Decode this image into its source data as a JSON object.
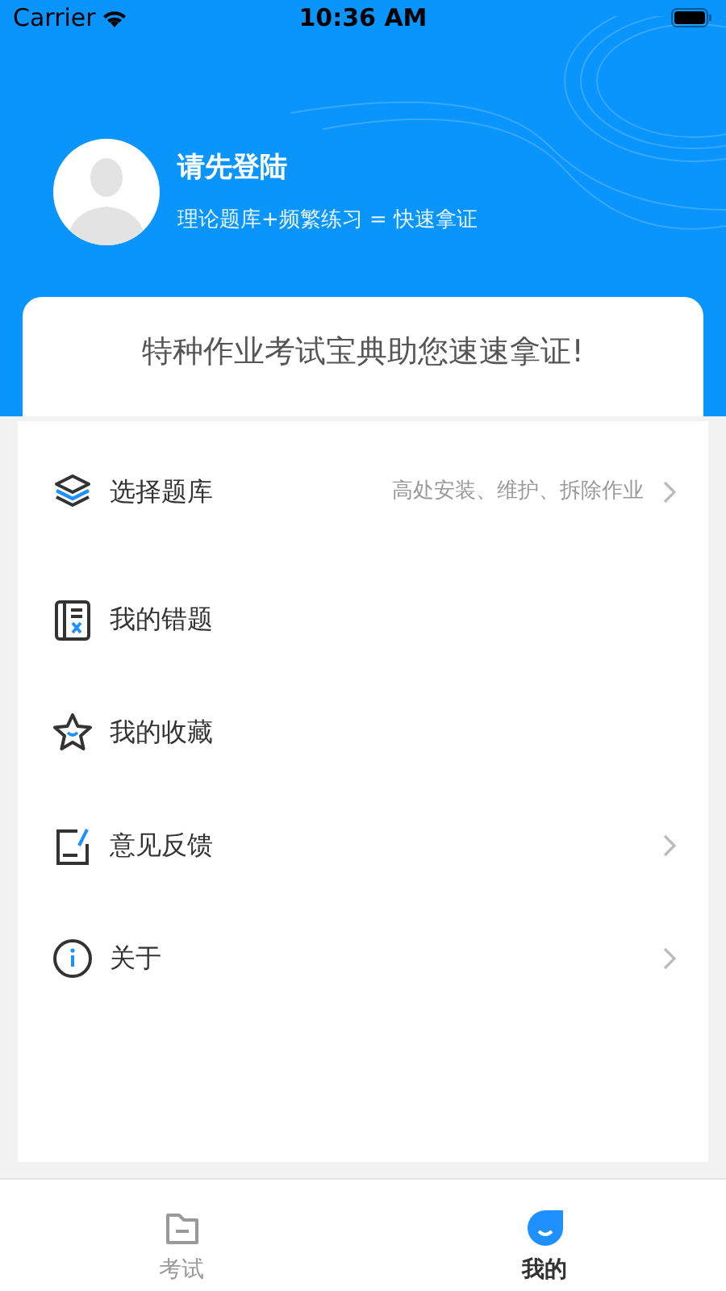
{
  "status_bar": {
    "carrier": "Carrier",
    "time": "10:36 AM"
  },
  "profile": {
    "name": "请先登陆",
    "tagline": "理论题库+频繁练习 = 快速拿证"
  },
  "banner": {
    "text": "特种作业考试宝典助您速速拿证!"
  },
  "menu": [
    {
      "kind": "layers",
      "label": "选择题库",
      "detail": "高处安装、维护、拆除作业",
      "chevron": true
    },
    {
      "kind": "mistakes",
      "label": "我的错题",
      "chevron": false
    },
    {
      "kind": "star",
      "label": "我的收藏",
      "chevron": false
    },
    {
      "kind": "feedback",
      "label": "意见反馈",
      "chevron": true
    },
    {
      "kind": "info",
      "label": "关于",
      "chevron": true
    }
  ],
  "tabs": [
    {
      "kind": "exam",
      "label": "考试",
      "selected": false
    },
    {
      "kind": "mine",
      "label": "我的",
      "selected": true
    }
  ]
}
